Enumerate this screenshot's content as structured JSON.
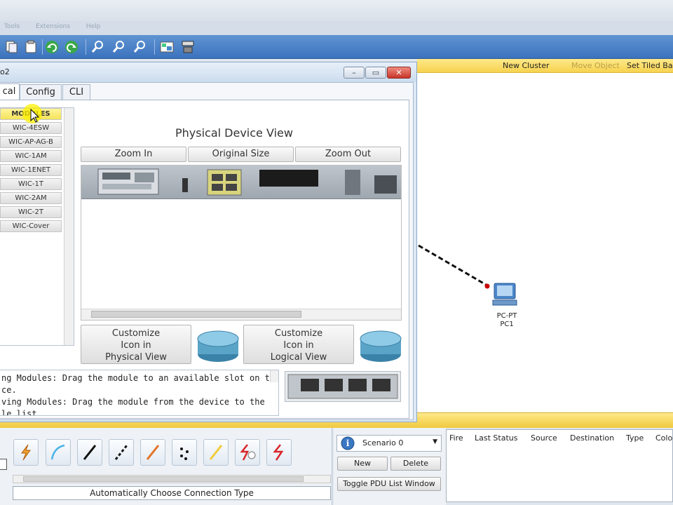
{
  "menubar": {
    "items": [
      "Tools",
      "Extensions",
      "Help"
    ]
  },
  "workspace_bar": {
    "new_cluster": "New Cluster",
    "move_object": "Move Object",
    "set_tiled": "Set Tiled Bac"
  },
  "pc_device": {
    "model": "PC-PT",
    "name": "PC1"
  },
  "dialog": {
    "title": "o2",
    "tabs": [
      "cal",
      "Config",
      "CLI"
    ],
    "modules_header": "MODULES",
    "modules": [
      "WIC-4ESW",
      "WIC-AP-AG-B",
      "WIC-1AM",
      "WIC-1ENET",
      "WIC-1T",
      "WIC-2AM",
      "WIC-2T",
      "WIC-Cover"
    ],
    "physical_title": "Physical Device View",
    "zoom_in": "Zoom In",
    "original_size": "Original Size",
    "zoom_out": "Zoom Out",
    "customize_physical": [
      "Customize",
      "Icon in",
      "Physical View"
    ],
    "customize_logical": [
      "Customize",
      "Icon in",
      "Logical View"
    ],
    "info_lines": [
      "ng Modules: Drag the module to an available slot on the",
      "ce.",
      "ving Modules: Drag the module from the device to the",
      "le list"
    ]
  },
  "bottom": {
    "connection_status": "Automatically Choose Connection Type",
    "scenario": "Scenario 0",
    "new_label": "New",
    "delete_label": "Delete",
    "toggle_label": "Toggle PDU List Window",
    "pdu_columns": [
      "Fire",
      "Last Status",
      "Source",
      "Destination",
      "Type",
      "Colo"
    ]
  },
  "colors": {
    "toolbar": "#3c73bd",
    "workspace_bar": "#f6d24e",
    "dialog_bg": "#dce8f5",
    "link": "#111111",
    "link_endpoint": "#cc0000"
  }
}
